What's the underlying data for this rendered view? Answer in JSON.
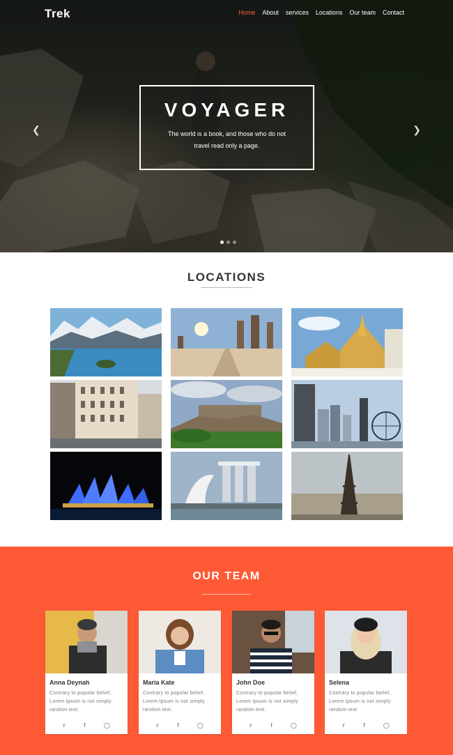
{
  "nav": {
    "brand": "Trek",
    "items": [
      {
        "label": "Home",
        "active": true
      },
      {
        "label": "About"
      },
      {
        "label": "services"
      },
      {
        "label": "Locations"
      },
      {
        "label": "Our team"
      },
      {
        "label": "Contact"
      }
    ]
  },
  "hero": {
    "title": "VOYAGER",
    "subtitle": "The world is a book, and those who do not travel read only a page.",
    "prev_icon": "chevron-left-icon",
    "next_icon": "chevron-right-icon",
    "slide_count": 3,
    "active_slide": 1
  },
  "locations": {
    "title": "LOCATIONS",
    "images": [
      "mountain-lake",
      "desert-road",
      "thai-temple",
      "city-street",
      "castle-hill",
      "city-skyline",
      "opera-house",
      "marina-bay",
      "eiffel-tower"
    ]
  },
  "team": {
    "title": "OUR TEAM",
    "members": [
      {
        "name": "Anna Deynah",
        "desc": "Contrary to popular belief, Lorem Ipsum is not simply random text."
      },
      {
        "name": "Maria Kate",
        "desc": "Contrary to popular belief, Lorem Ipsum is not simply random text."
      },
      {
        "name": "John Doe",
        "desc": "Contrary to popular belief, Lorem Ipsum is not simply random text."
      },
      {
        "name": "Selena",
        "desc": "Contrary to popular belief, Lorem Ipsum is not simply random text."
      }
    ],
    "social_icons": [
      "twitter-icon",
      "facebook-icon",
      "instagram-icon"
    ]
  },
  "colors": {
    "accent": "#ff5a36"
  }
}
